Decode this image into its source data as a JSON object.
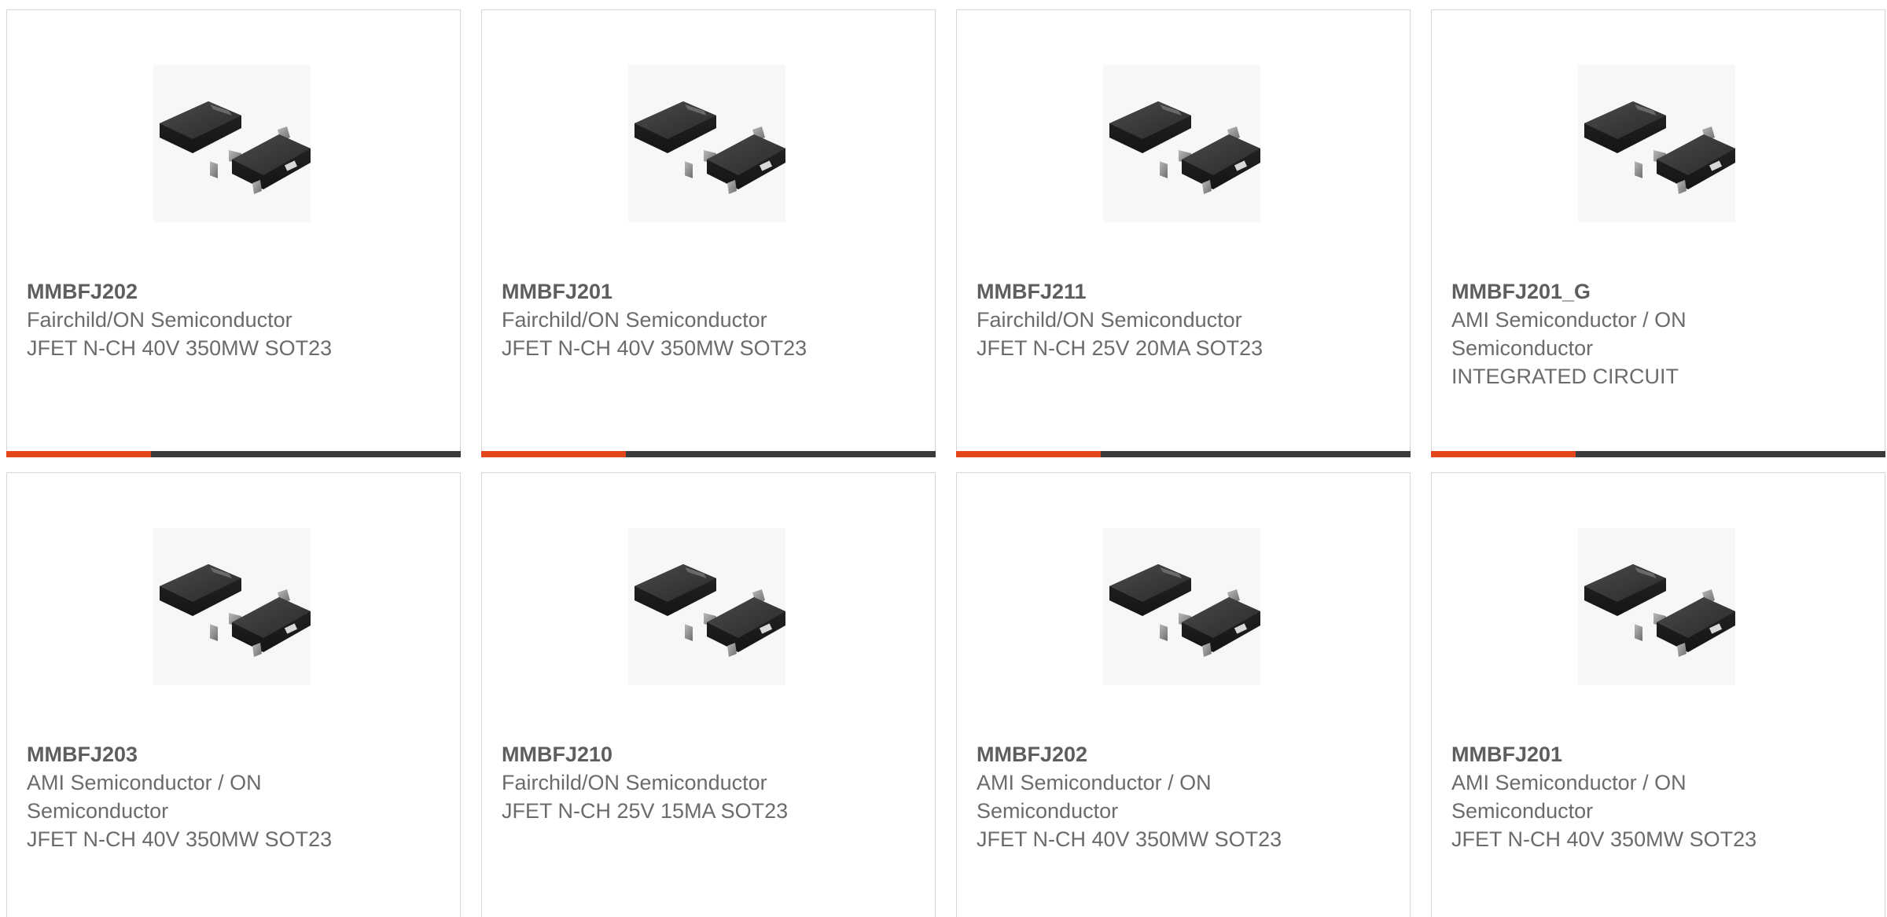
{
  "products": [
    {
      "part": "MMBFJ202",
      "manufacturer": "Fairchild/ON Semiconductor",
      "description": "JFET N-CH 40V 350MW SOT23",
      "image_icon": "sot23-package-icon"
    },
    {
      "part": "MMBFJ201",
      "manufacturer": "Fairchild/ON Semiconductor",
      "description": "JFET N-CH 40V 350MW SOT23",
      "image_icon": "sot23-package-icon"
    },
    {
      "part": "MMBFJ211",
      "manufacturer": "Fairchild/ON Semiconductor",
      "description": "JFET N-CH 25V 20MA SOT23",
      "image_icon": "sot23-package-icon"
    },
    {
      "part": "MMBFJ201_G",
      "manufacturer": "AMI Semiconductor / ON Semiconductor",
      "description": "INTEGRATED CIRCUIT",
      "image_icon": "sot23-package-icon"
    },
    {
      "part": "MMBFJ203",
      "manufacturer": "AMI Semiconductor / ON Semiconductor",
      "description": "JFET N-CH 40V 350MW SOT23",
      "image_icon": "sot23-package-icon"
    },
    {
      "part": "MMBFJ210",
      "manufacturer": "Fairchild/ON Semiconductor",
      "description": "JFET N-CH 25V 15MA SOT23",
      "image_icon": "sot23-package-icon"
    },
    {
      "part": "MMBFJ202",
      "manufacturer": "AMI Semiconductor / ON Semiconductor",
      "description": "JFET N-CH 40V 350MW SOT23",
      "image_icon": "sot23-package-icon"
    },
    {
      "part": "MMBFJ201",
      "manufacturer": "AMI Semiconductor / ON Semiconductor",
      "description": "JFET N-CH 40V 350MW SOT23",
      "image_icon": "sot23-package-icon"
    }
  ],
  "colors": {
    "accent": "#e2461c",
    "bar": "#3a3a3a",
    "border": "#d6d6d6",
    "text": "#6b6b6b"
  }
}
